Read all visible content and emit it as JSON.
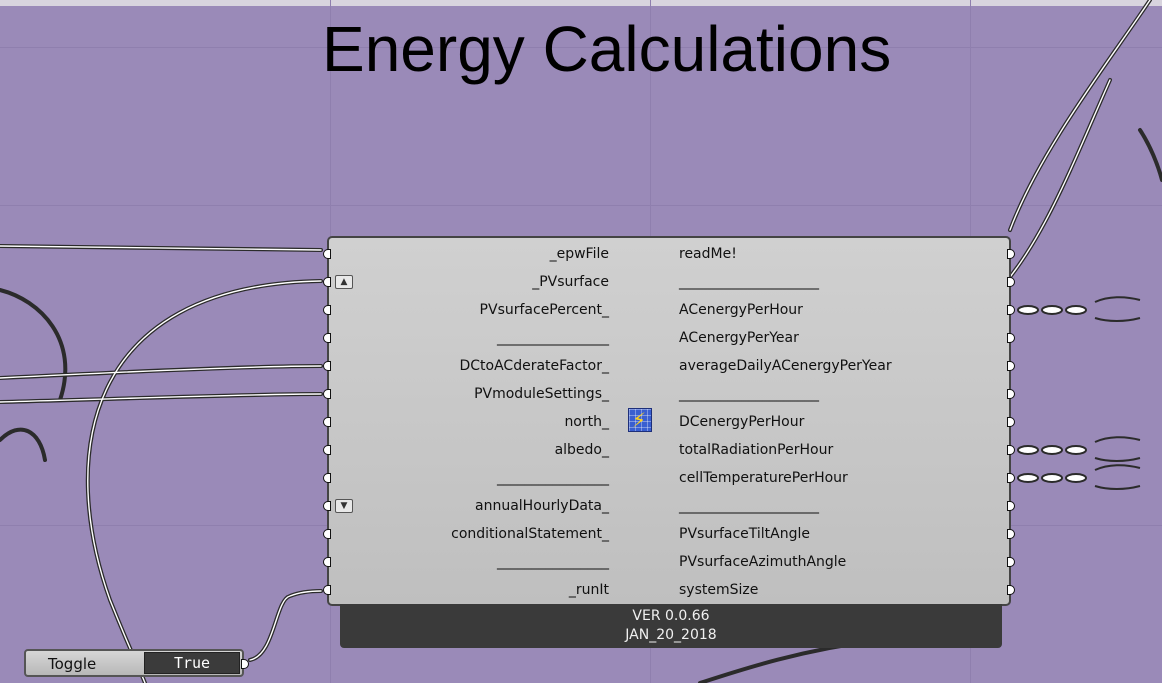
{
  "canvas": {
    "title": "Energy Calculations",
    "background_color": "#9a8ab8"
  },
  "component": {
    "icon": "lightning-bolt-grid-icon",
    "inputs": [
      {
        "label": "_epwFile"
      },
      {
        "label": "_PVsurface",
        "scroll": "up"
      },
      {
        "label": "PVsurfacePercent_"
      },
      {
        "label": "________________"
      },
      {
        "label": "DCtoACderateFactor_"
      },
      {
        "label": "PVmoduleSettings_"
      },
      {
        "label": "north_"
      },
      {
        "label": "albedo_"
      },
      {
        "label": "________________"
      },
      {
        "label": "annualHourlyData_",
        "scroll": "down"
      },
      {
        "label": "conditionalStatement_"
      },
      {
        "label": "________________"
      },
      {
        "label": "_runIt"
      }
    ],
    "outputs": [
      {
        "label": "readMe!"
      },
      {
        "label": "____________________"
      },
      {
        "label": "ACenergyPerHour"
      },
      {
        "label": "ACenergyPerYear"
      },
      {
        "label": "averageDailyACenergyPerYear"
      },
      {
        "label": "____________________"
      },
      {
        "label": "DCenergyPerHour"
      },
      {
        "label": "totalRadiationPerHour"
      },
      {
        "label": "cellTemperaturePerHour"
      },
      {
        "label": "____________________"
      },
      {
        "label": "PVsurfaceTiltAngle"
      },
      {
        "label": "PVsurfaceAzimuthAngle"
      },
      {
        "label": "systemSize"
      }
    ],
    "version": "VER 0.0.66",
    "date": "JAN_20_2018"
  },
  "toggle": {
    "label": "Toggle",
    "value": "True"
  }
}
